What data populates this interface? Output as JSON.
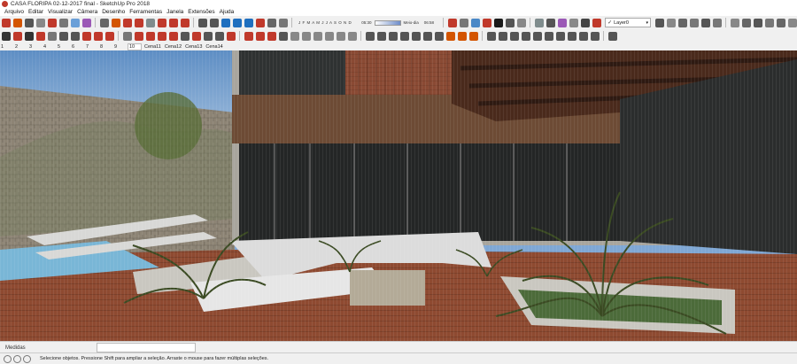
{
  "window": {
    "title": "CASA FLORIPA 02-12-2017 final - SketchUp Pro 2018"
  },
  "menu": [
    "Arquivo",
    "Editar",
    "Visualizar",
    "Câmera",
    "Desenho",
    "Ferramentas",
    "Janela",
    "Extensões",
    "Ajuda"
  ],
  "toolbar1": {
    "icon_colors": [
      "#c0392b",
      "#d35400",
      "#555",
      "#888",
      "#c0392b",
      "#777",
      "#6a9fd8",
      "#9b59b6",
      "#666",
      "#d35400",
      "#c0392b",
      "#c0392b",
      "#7f8c8d",
      "#c0392b",
      "#c0392b",
      "#c0392b",
      "#555",
      "#555",
      "#1f6fbf",
      "#1f6fbf",
      "#1f6fbf",
      "#c0392b",
      "#666",
      "#777"
    ],
    "shadow_months": "J F M A M J J A S O N D",
    "shadow_time_start": "05:30",
    "shadow_time_mid": "Meio-dia",
    "shadow_time_end": "06:58",
    "icon_colors_b": [
      "#c0392b",
      "#777",
      "#4a88c7",
      "#c0392b",
      "#1a1a1a",
      "#555",
      "#888",
      "#7f8c8d",
      "#555",
      "#9b59b6",
      "#888",
      "#444",
      "#c0392b"
    ],
    "layer": {
      "check": "✓",
      "name": "Layer0"
    },
    "icon_colors_c": [
      "#555",
      "#888",
      "#666",
      "#777",
      "#555",
      "#777",
      "#888",
      "#666",
      "#555",
      "#777",
      "#666",
      "#888"
    ]
  },
  "toolbar2": {
    "icon_colors": [
      "#333",
      "#c0392b",
      "#333",
      "#c0392b",
      "#777",
      "#555",
      "#555",
      "#c0392b",
      "#c0392b",
      "#c0392b",
      "#777",
      "#c0392b",
      "#c0392b",
      "#c0392b",
      "#c0392b",
      "#555",
      "#c0392b",
      "#555",
      "#555",
      "#c0392b",
      "#c0392b",
      "#c0392b",
      "#c0392b",
      "#555",
      "#888",
      "#888",
      "#888",
      "#888",
      "#888",
      "#888",
      "#555",
      "#555",
      "#555",
      "#555",
      "#555",
      "#555",
      "#555",
      "#d35400",
      "#d35400",
      "#d35400",
      "#555",
      "#555",
      "#555",
      "#555",
      "#555",
      "#555",
      "#555",
      "#555",
      "#555",
      "#555",
      "#555"
    ]
  },
  "scene_tabs": [
    "1",
    "2",
    "3",
    "4",
    "5",
    "6",
    "7",
    "8",
    "9",
    "10",
    "Cena11",
    "Cena12",
    "Cena13",
    "Cena14"
  ],
  "active_tab": "10",
  "measurements": {
    "label": "Medidas"
  },
  "status": {
    "message": "Selecione objetos. Pressione Shift para ampliar a seleção. Arraste o mouse para fazer múltiplas seleções."
  }
}
